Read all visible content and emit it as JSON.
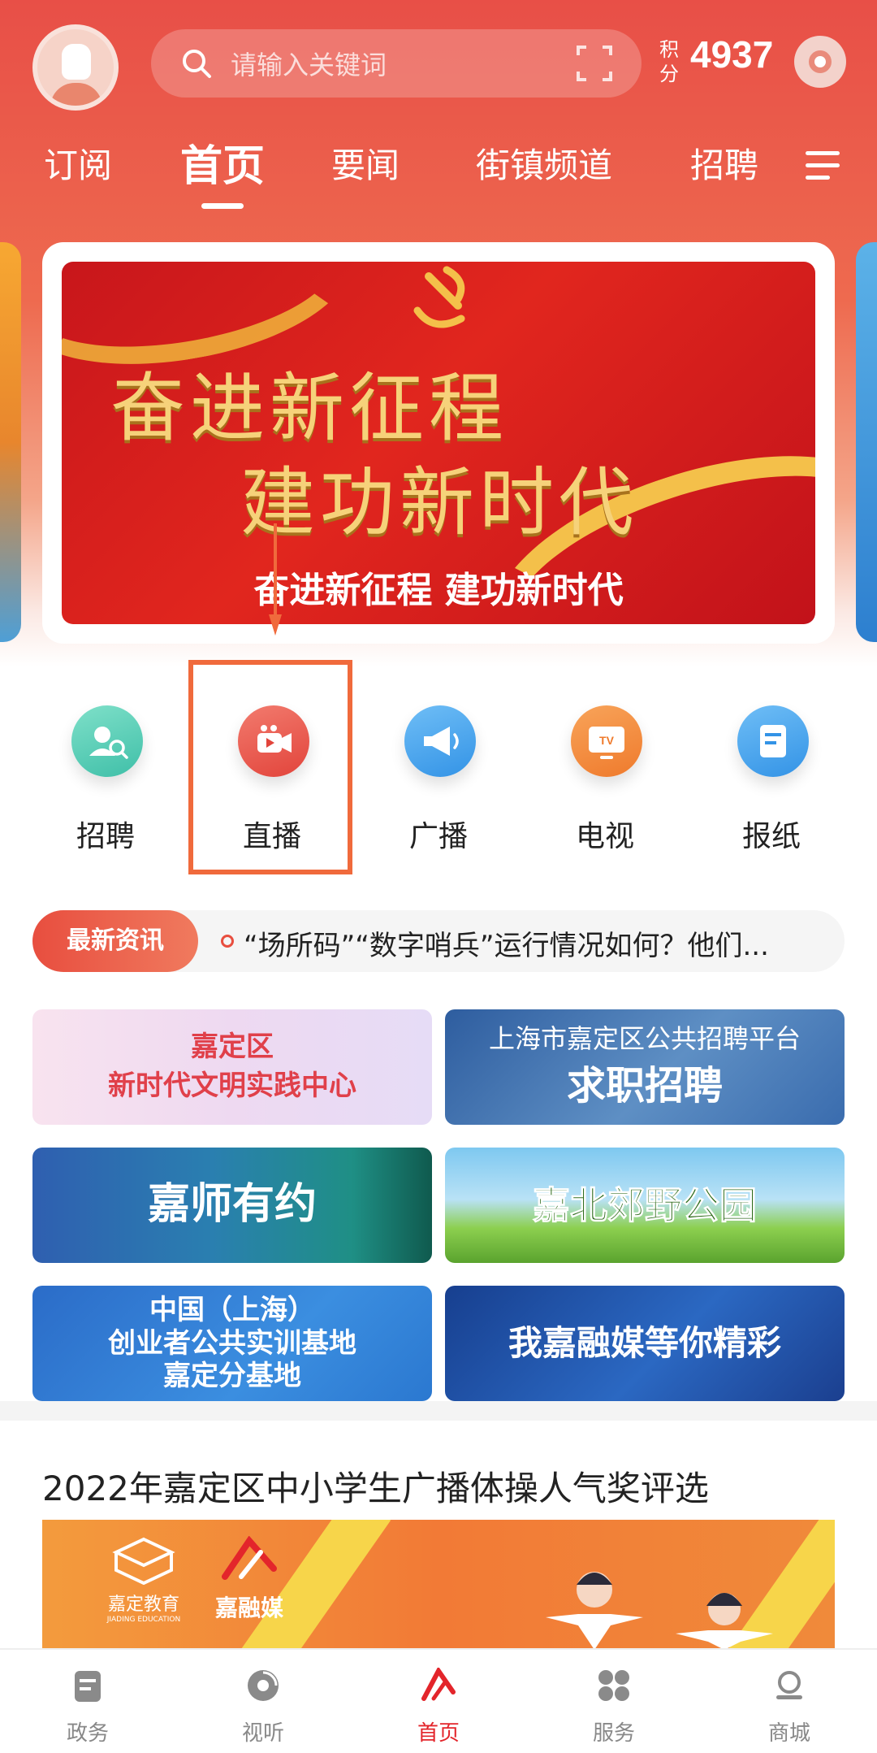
{
  "header": {
    "search_placeholder": "请输入关键词",
    "points_label": "积分",
    "points_value": "4937"
  },
  "tabs": [
    {
      "label": "订阅",
      "active": false
    },
    {
      "label": "首页",
      "active": true
    },
    {
      "label": "要闻",
      "active": false
    },
    {
      "label": "街镇频道",
      "active": false
    },
    {
      "label": "招聘",
      "active": false
    }
  ],
  "banner": {
    "slogan_line1": "奋进新征程",
    "slogan_line2": "建功新时代",
    "caption": "奋进新征程 建功新时代"
  },
  "quick_links": [
    {
      "label": "招聘",
      "icon": "recruit-icon",
      "color": "#5ccfb8"
    },
    {
      "label": "直播",
      "icon": "live-video-icon",
      "color": "#ec5a4d"
    },
    {
      "label": "广播",
      "icon": "broadcast-megaphone-icon",
      "color": "#4aa6ee"
    },
    {
      "label": "电视",
      "icon": "tv-icon",
      "color": "#f28a3c"
    },
    {
      "label": "报纸",
      "icon": "newspaper-icon",
      "color": "#4aa6ee"
    }
  ],
  "ticker": {
    "badge": "最新资讯",
    "text": "“场所码”“数字哨兵”运行情况如何？他们..."
  },
  "promos": [
    {
      "line1": "嘉定区",
      "line2": "新时代文明实践中心"
    },
    {
      "line1": "上海市嘉定区公共招聘平台",
      "line2": "求职招聘"
    },
    {
      "line1": "嘉师有约"
    },
    {
      "line1": "嘉北郊野公园"
    },
    {
      "line1": "中国（上海）",
      "line2": "创业者公共实训基地",
      "line3": "嘉定分基地"
    },
    {
      "line1": "我嘉融媒等你精彩"
    }
  ],
  "article": {
    "title": "2022年嘉定区中小学生广播体操人气奖评选",
    "logo1": "嘉定教育",
    "logo1_sub": "JIADING EDUCATION",
    "logo2": "嘉融媒"
  },
  "bottom_nav": [
    {
      "label": "政务",
      "active": false
    },
    {
      "label": "视听",
      "active": false
    },
    {
      "label": "首页",
      "active": true
    },
    {
      "label": "服务",
      "active": false
    },
    {
      "label": "商城",
      "active": false
    }
  ],
  "colors": {
    "brand_red": "#e3252b",
    "highlight_orange": "#f06a3c"
  }
}
